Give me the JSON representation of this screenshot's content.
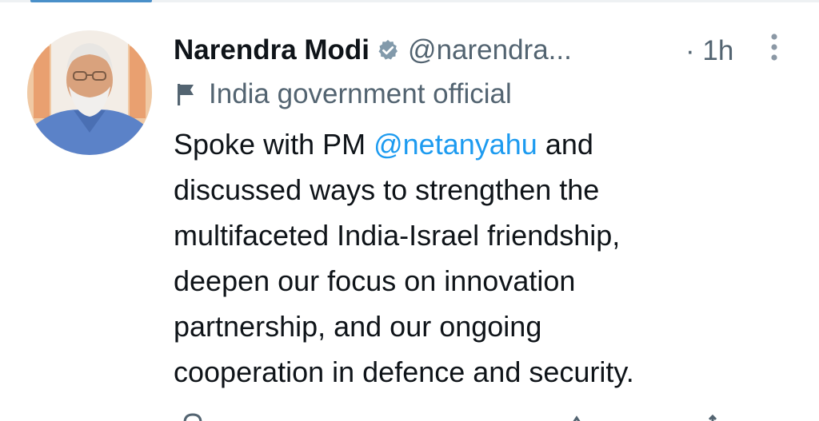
{
  "tweet": {
    "display_name": "Narendra Modi",
    "handle": "@narendra...",
    "time": "· 1h",
    "label": "India government official",
    "text_before_mention": "Spoke with PM ",
    "mention": "@netanyahu",
    "text_after_mention": " and",
    "lines": [
      "discussed ways to strengthen the",
      "multifaceted India-Israel friendship,",
      "deepen our focus on innovation",
      "partnership, and our ongoing",
      "cooperation in defence and security."
    ]
  },
  "icons": {
    "verified": "verified-badge-icon",
    "label": "flag-icon",
    "more": "more-vertical-icon"
  },
  "colors": {
    "text": "#0f1419",
    "secondary": "#536471",
    "mention": "#1d9bf0",
    "verified": "#829aab"
  }
}
